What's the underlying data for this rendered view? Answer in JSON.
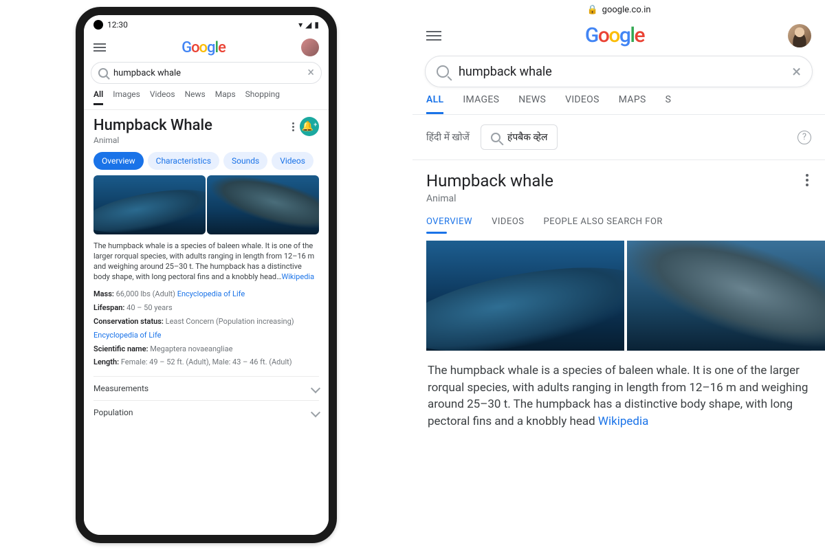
{
  "phone": {
    "status": {
      "time": "12:30"
    },
    "header": {
      "logo_letters": [
        "G",
        "o",
        "o",
        "g",
        "l",
        "e"
      ]
    },
    "search": {
      "query": "humpback whale"
    },
    "tabs": [
      "All",
      "Images",
      "Videos",
      "News",
      "Maps",
      "Shopping"
    ],
    "active_tab": "All",
    "kp": {
      "title": "Humpback Whale",
      "subtitle": "Animal",
      "pills": [
        "Overview",
        "Characteristics",
        "Sounds",
        "Videos"
      ],
      "active_pill": "Overview",
      "description": "The humpback whale is a species of baleen whale. It is one of the larger rorqual species, with adults ranging in length from 12–16 m and weighing around 25–30 t. The humpback has a distinctive body shape, with long pectoral fins and a knobbly head…",
      "description_source": "Wikipedia",
      "facts": {
        "mass_label": "Mass:",
        "mass_value": "66,000 lbs (Adult)",
        "mass_source": "Encyclopedia of Life",
        "lifespan_label": "Lifespan:",
        "lifespan_value": "40 – 50 years",
        "cons_label": "Conservation status:",
        "cons_value": "Least Concern (Population increasing)",
        "cons_source": "Encyclopedia of Life",
        "sci_label": "Scientific name:",
        "sci_value": "Megaptera novaeangliae",
        "length_label": "Length:",
        "length_value": "Female: 49 – 52 ft. (Adult), Male: 43 – 46 ft. (Adult)"
      },
      "expanders": [
        "Measurements",
        "Population"
      ]
    }
  },
  "browser": {
    "address": "google.co.in",
    "header": {
      "logo_letters": [
        "G",
        "o",
        "o",
        "g",
        "l",
        "e"
      ]
    },
    "search": {
      "query": "humpback whale"
    },
    "tabs": [
      "ALL",
      "IMAGES",
      "NEWS",
      "VIDEOS",
      "MAPS",
      "S"
    ],
    "active_tab": "ALL",
    "hindi": {
      "label": "हिंदी में खोजें",
      "chip": "हंपबैक व्हेल"
    },
    "kp": {
      "title": "Humpback whale",
      "subtitle": "Animal",
      "tabs": [
        "OVERVIEW",
        "VIDEOS",
        "PEOPLE ALSO SEARCH FOR"
      ],
      "active_tab": "OVERVIEW",
      "description": "The humpback whale is a species of baleen whale. It is one of the larger rorqual species, with adults ranging in length from 12–16 m and weighing around 25–30 t. The humpback has a distinctive body shape, with long pectoral fins and a knobbly",
      "description_tail": "head ",
      "description_source": "Wikipedia"
    }
  }
}
